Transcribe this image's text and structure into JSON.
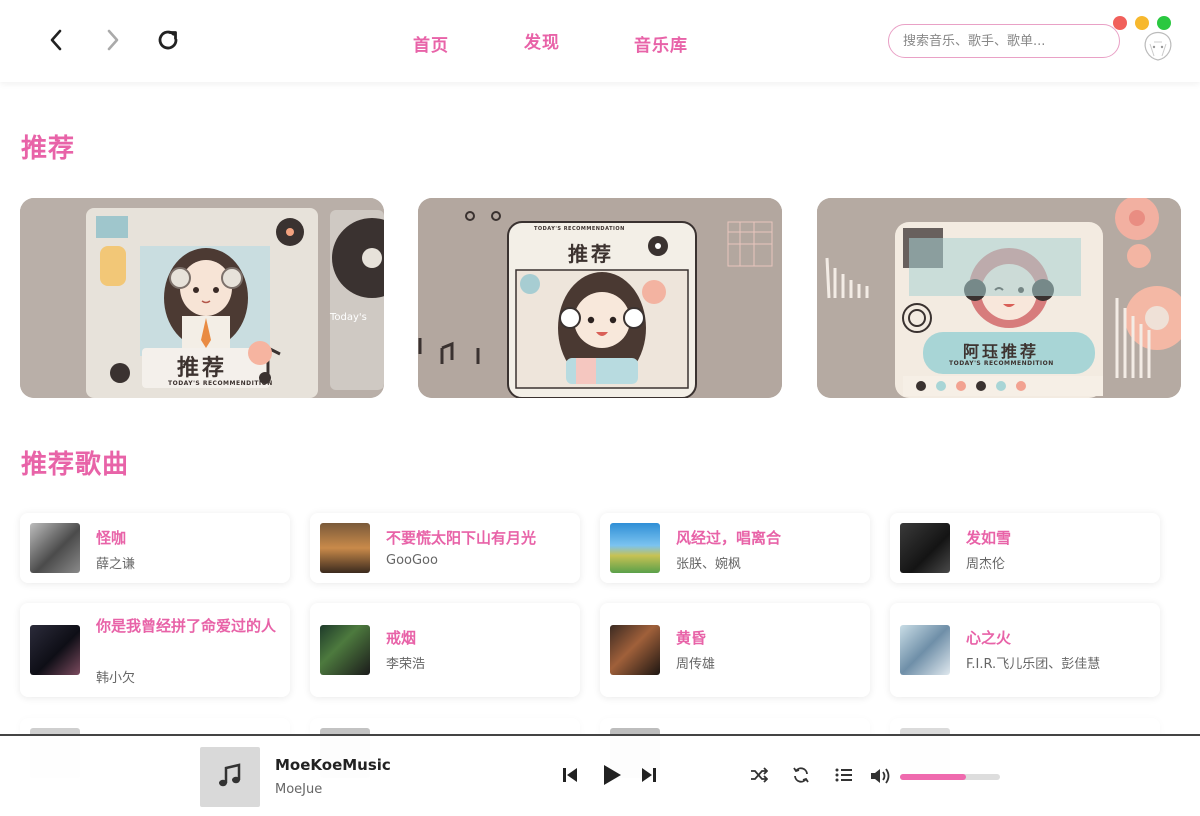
{
  "nav": {
    "menu": [
      "首页",
      "发现",
      "音乐库"
    ],
    "search_placeholder": "搜索音乐、歌手、歌单..."
  },
  "sections": {
    "recommend_title": "推荐",
    "songs_title": "推荐歌曲"
  },
  "banners": [
    {
      "label": "推荐",
      "sub": "TODAY'S RECOMMENDITION",
      "side": "Today's"
    },
    {
      "label": "推荐",
      "sub": "TODAY'S RECOMMENDATION"
    },
    {
      "label": "阿珏推荐",
      "sub": "TODAY'S RECOMMENDITION"
    }
  ],
  "songs": [
    {
      "title": "怪咖",
      "artist": "薛之谦"
    },
    {
      "title": "不要慌太阳下山有月光",
      "artist": "GooGoo"
    },
    {
      "title": "风经过，唱离合",
      "artist": "张朕、婉枫"
    },
    {
      "title": "发如雪",
      "artist": "周杰伦"
    },
    {
      "title": "你是我曾经拼了命爱过的人",
      "artist": "韩小欠"
    },
    {
      "title": "戒烟",
      "artist": "李荣浩"
    },
    {
      "title": "黄昏",
      "artist": "周传雄"
    },
    {
      "title": "心之火",
      "artist": "F.I.R.飞儿乐团、彭佳慧"
    }
  ],
  "player": {
    "title": "MoeKoeMusic",
    "artist": "MoeJue",
    "volume": 0.66
  },
  "colors": {
    "accent": "#e863a8",
    "volume_fill": "#ef6aae"
  }
}
